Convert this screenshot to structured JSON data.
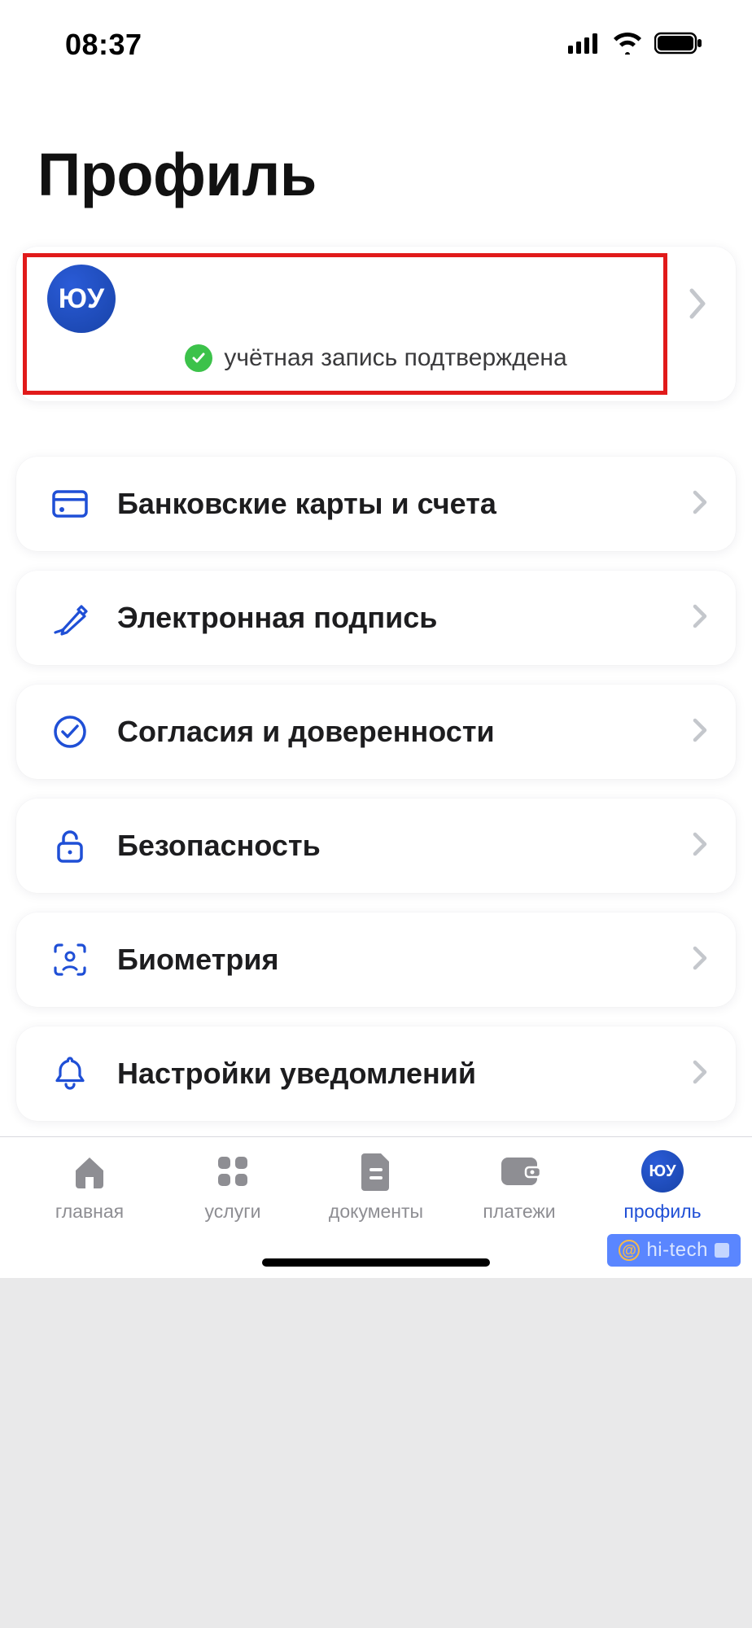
{
  "status_bar": {
    "time": "08:37"
  },
  "page": {
    "title": "Профиль"
  },
  "profile": {
    "avatar_initials": "ЮУ",
    "verified_text": "учётная запись подтверждена"
  },
  "menu": [
    {
      "id": "bank-cards",
      "icon": "card-icon",
      "label": "Банковские карты и счета"
    },
    {
      "id": "e-signature",
      "icon": "pen-icon",
      "label": "Электронная подпись"
    },
    {
      "id": "consents",
      "icon": "consent-icon",
      "label": "Согласия и доверенности"
    },
    {
      "id": "security",
      "icon": "lock-icon",
      "label": "Безопасность"
    },
    {
      "id": "biometrics",
      "icon": "face-id-icon",
      "label": "Биометрия"
    },
    {
      "id": "notifications",
      "icon": "bell-icon",
      "label": "Настройки уведомлений"
    }
  ],
  "tabs": [
    {
      "id": "home",
      "label": "главная",
      "active": false
    },
    {
      "id": "services",
      "label": "услуги",
      "active": false
    },
    {
      "id": "documents",
      "label": "документы",
      "active": false
    },
    {
      "id": "payments",
      "label": "платежи",
      "active": false
    },
    {
      "id": "profile",
      "label": "профиль",
      "active": true,
      "avatar_initials": "ЮУ"
    }
  ],
  "watermark": {
    "text": "hi-tech"
  }
}
